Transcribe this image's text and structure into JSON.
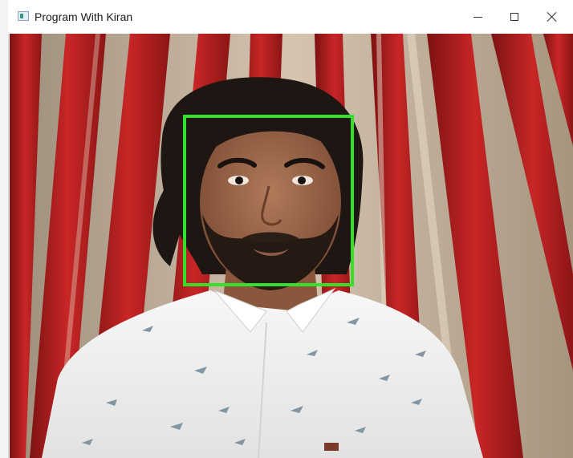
{
  "window": {
    "title": "Program With Kiran",
    "icon": "app-window-icon",
    "controls": [
      "minimize-icon",
      "maximize-icon",
      "close-icon"
    ]
  },
  "video": {
    "content": "webcam-frame",
    "detection": {
      "label": "",
      "box_color": "#35e02a"
    }
  },
  "colors": {
    "curtain_red": "#b81f1f",
    "curtain_beige": "#c9b8a4",
    "shirt": "#f2f2f2",
    "box": "#35e02a"
  }
}
